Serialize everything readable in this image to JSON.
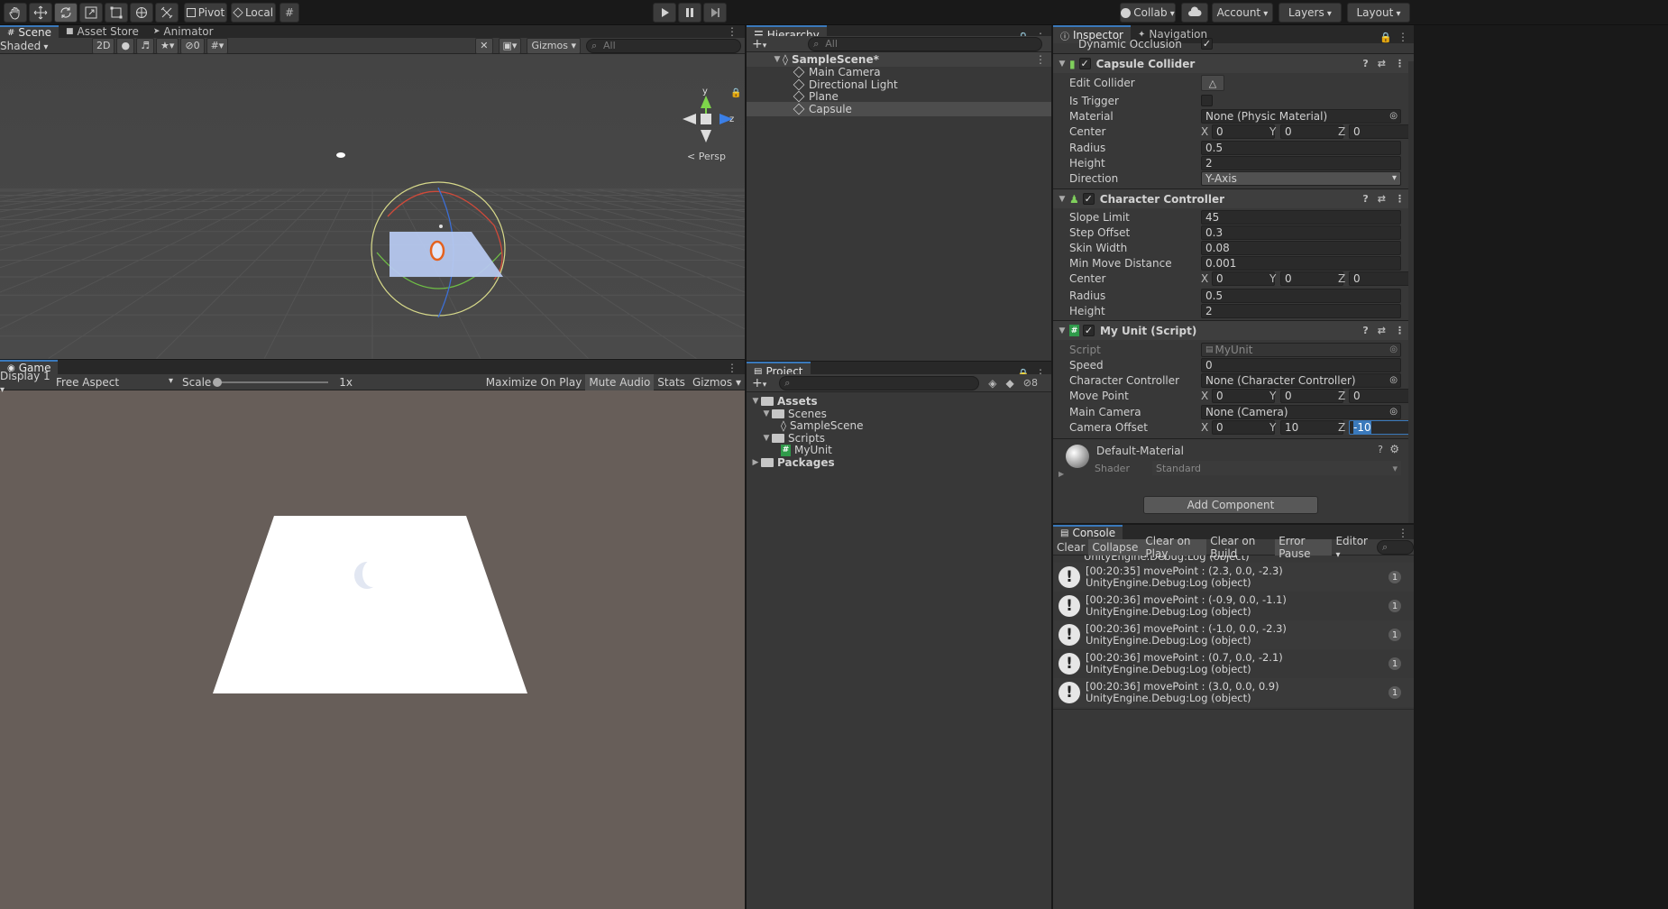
{
  "toolbar": {
    "pivot_label": "Pivot",
    "local_label": "Local",
    "collab_label": "Collab",
    "account_label": "Account",
    "layers_label": "Layers",
    "layout_label": "Layout"
  },
  "scene_panel": {
    "tabs": [
      "Scene",
      "Asset Store",
      "Animator"
    ],
    "shading_mode": "Shaded",
    "mode_2d": "2D",
    "hidden_count": "0",
    "gizmos_label": "Gizmos",
    "search_placeholder": "All",
    "persp_label": "Persp",
    "axis_y": "y",
    "axis_z": "z"
  },
  "game_panel": {
    "tab": "Game",
    "display": "Display 1",
    "aspect": "Free Aspect",
    "scale_label": "Scale",
    "scale_value": "1x",
    "maximize_label": "Maximize On Play",
    "mute_label": "Mute Audio",
    "stats_label": "Stats",
    "gizmos_label": "Gizmos"
  },
  "hierarchy": {
    "tab": "Hierarchy",
    "search_placeholder": "All",
    "scene_name": "SampleScene*",
    "items": [
      "Main Camera",
      "Directional Light",
      "Plane",
      "Capsule"
    ]
  },
  "project": {
    "tab": "Project",
    "hidden_count": "8",
    "assets": "Assets",
    "scenes": "Scenes",
    "scene_file": "SampleScene",
    "scripts": "Scripts",
    "script_file": "MyUnit",
    "packages": "Packages"
  },
  "inspector": {
    "tabs": [
      "Inspector",
      "Navigation"
    ],
    "dynamic_occlusion": "Dynamic Occlusion",
    "capsule_collider": {
      "title": "Capsule Collider",
      "edit_collider": "Edit Collider",
      "is_trigger": "Is Trigger",
      "material_label": "Material",
      "material_value": "None (Physic Material)",
      "center_label": "Center",
      "center": [
        "0",
        "0",
        "0"
      ],
      "radius_label": "Radius",
      "radius": "0.5",
      "height_label": "Height",
      "height": "2",
      "direction_label": "Direction",
      "direction": "Y-Axis"
    },
    "character_controller": {
      "title": "Character Controller",
      "slope_label": "Slope Limit",
      "slope": "45",
      "step_label": "Step Offset",
      "step": "0.3",
      "skin_label": "Skin Width",
      "skin": "0.08",
      "minmove_label": "Min Move Distance",
      "minmove": "0.001",
      "center_label": "Center",
      "center": [
        "0",
        "0",
        "0"
      ],
      "radius_label": "Radius",
      "radius": "0.5",
      "height_label": "Height",
      "height": "2"
    },
    "my_unit": {
      "title": "My Unit (Script)",
      "script_label": "Script",
      "script": "MyUnit",
      "speed_label": "Speed",
      "speed": "0",
      "cc_label": "Character Controller",
      "cc": "None (Character Controller)",
      "movepoint_label": "Move Point",
      "movepoint": [
        "0",
        "0",
        "0"
      ],
      "camera_label": "Main Camera",
      "camera": "None (Camera)",
      "offset_label": "Camera Offset",
      "offset": [
        "0",
        "10",
        "-10"
      ]
    },
    "material": {
      "name": "Default-Material",
      "shader_label": "Shader",
      "shader": "Standard"
    },
    "add_component": "Add Component",
    "axis_x": "X",
    "axis_y": "Y",
    "axis_z": "Z"
  },
  "console": {
    "tab": "Console",
    "buttons": [
      "Clear",
      "Collapse",
      "Clear on Play",
      "Clear on Build",
      "Error Pause",
      "Editor"
    ],
    "partial_line": "UnityEngine.Debug:Log (object)",
    "entries": [
      {
        "line1": "[00:20:35] movePoint : (2.3, 0.0, -2.3)",
        "line2": "UnityEngine.Debug:Log (object)",
        "count": "1"
      },
      {
        "line1": "[00:20:36] movePoint : (-0.9, 0.0, -1.1)",
        "line2": "UnityEngine.Debug:Log (object)",
        "count": "1"
      },
      {
        "line1": "[00:20:36] movePoint : (-1.0, 0.0, -2.3)",
        "line2": "UnityEngine.Debug:Log (object)",
        "count": "1"
      },
      {
        "line1": "[00:20:36] movePoint : (0.7, 0.0, -2.1)",
        "line2": "UnityEngine.Debug:Log (object)",
        "count": "1"
      },
      {
        "line1": "[00:20:36] movePoint : (3.0, 0.0, 0.9)",
        "line2": "UnityEngine.Debug:Log (object)",
        "count": "1"
      }
    ]
  }
}
